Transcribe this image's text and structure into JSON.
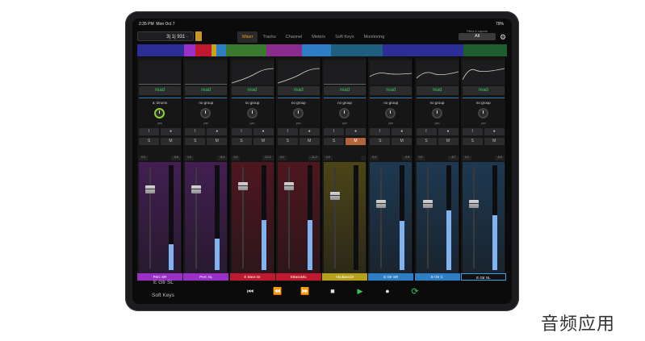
{
  "status": {
    "time": "2:35 PM",
    "date": "Mon Oct 7",
    "battery": "79%"
  },
  "position": {
    "value": "3| 1| 931 ·"
  },
  "tabs": [
    "Mixer",
    "Tracks",
    "Channel",
    "Meters",
    "Soft Keys",
    "Monitoring"
  ],
  "active_tab": "Mixer",
  "filter": {
    "label": "Filters & Layouts",
    "value": "All"
  },
  "channels": [
    {
      "name": "Perc SR",
      "group": "a: Drums",
      "automation": "read",
      "mute_on": false,
      "val_left": "0.0",
      "val_right": "-8.8",
      "meter_level": 0.25,
      "fader_level": 0.8,
      "color": "#9b30c8"
    },
    {
      "name": "Perc SL",
      "group": "no group",
      "automation": "read",
      "mute_on": false,
      "val_left": "0.0",
      "val_right": "-8.4",
      "meter_level": 0.3,
      "fader_level": 0.8,
      "color": "#9b30c8"
    },
    {
      "name": "E Bass DI",
      "group": "no group",
      "automation": "read",
      "mute_on": false,
      "val_left": "0.0",
      "val_right": "-12.3",
      "meter_level": 0.48,
      "fader_level": 0.83,
      "color": "#c0182e"
    },
    {
      "name": "EBassMic",
      "group": "no group",
      "automation": "read",
      "mute_on": false,
      "val_left": "0.0",
      "val_right": "-11.2",
      "meter_level": 0.48,
      "fader_level": 0.83,
      "color": "#c0182e"
    },
    {
      "name": "AkuBassDI",
      "group": "no group",
      "automation": "read",
      "mute_on": true,
      "val_left": "0.0",
      "val_right": "",
      "meter_level": 0.0,
      "fader_level": 0.74,
      "color": "#b7a11a"
    },
    {
      "name": "E Gtr SR",
      "group": "no group",
      "automation": "read",
      "mute_on": false,
      "val_left": "0.0",
      "val_right": "-9.8",
      "meter_level": 0.47,
      "fader_level": 0.66,
      "color": "#2e7ec5"
    },
    {
      "name": "E Gtr C",
      "group": "no group",
      "automation": "read",
      "mute_on": false,
      "val_left": "0.0",
      "val_right": "-8.7",
      "meter_level": 0.57,
      "fader_level": 0.66,
      "color": "#2e7ec5"
    },
    {
      "name": "E Gtr SL",
      "group": "no group",
      "automation": "read",
      "mute_on": false,
      "val_left": "0.0",
      "val_right": "-8.8",
      "meter_level": 0.52,
      "fader_level": 0.66,
      "color": "#2e7ec5"
    }
  ],
  "button_labels": {
    "rec": "I",
    "monitor": "●",
    "solo": "S",
    "mute": "M"
  },
  "pan_label": "pan",
  "selected_channel": "E Gtr SL",
  "soft_keys": "Soft Keys",
  "transport": {
    "to_start": "⏮",
    "rewind": "⏪",
    "forward": "⏩",
    "stop": "■",
    "play": "▶",
    "record": "●",
    "cycle": "⟳"
  },
  "colors": {
    "accent": "#ff9f0a",
    "play": "#34c759",
    "meter": "#7fb4f0"
  },
  "watermark": "音频应用"
}
